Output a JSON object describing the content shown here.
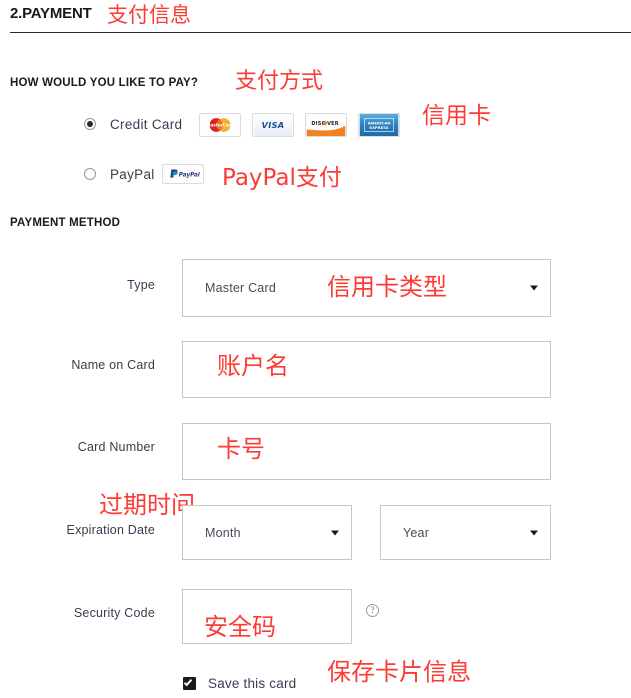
{
  "section": {
    "title": "2.PAYMENT",
    "title_annotation": "支付信息"
  },
  "pay_question": {
    "label": "HOW WOULD YOU LIKE TO PAY?",
    "annotation": "支付方式"
  },
  "payment_options": {
    "credit": {
      "label": "Credit Card",
      "selected": true,
      "annotation": "信用卡",
      "logos": [
        {
          "name": "mastercard-logo",
          "alt": "MasterCard"
        },
        {
          "name": "visa-logo",
          "alt": "VISA"
        },
        {
          "name": "discover-logo",
          "alt": "DISCOVER"
        },
        {
          "name": "amex-logo",
          "alt": "AMERICAN EXPRESS"
        }
      ]
    },
    "paypal": {
      "label": "PayPal",
      "selected": false,
      "annotation": "PayPal支付",
      "logo_alt": "PayPal"
    }
  },
  "payment_method": {
    "heading": "PAYMENT METHOD",
    "fields": {
      "type": {
        "label": "Type",
        "value": "Master Card",
        "annotation": "信用卡类型",
        "options": [
          "Master Card"
        ]
      },
      "name_on_card": {
        "label": "Name on Card",
        "value": "",
        "annotation": "账户名"
      },
      "card_number": {
        "label": "Card Number",
        "value": "",
        "annotation": "卡号"
      },
      "expiration_date": {
        "label": "Expiration Date",
        "annotation": "过期时间",
        "month_value": "Month",
        "year_value": "Year"
      },
      "security_code": {
        "label": "Security Code",
        "value": "",
        "annotation": "安全码",
        "help_glyph": "?"
      },
      "save_card": {
        "label": "Save this card",
        "checked": true,
        "annotation": "保存卡片信息"
      }
    }
  },
  "colors": {
    "annotation_red": "#fc3b35",
    "text": "#3b3b4f",
    "heading": "#1a1a1a",
    "border": "#c9c6c3",
    "visa_blue": "#1a4d8f",
    "mastercard_red": "#d8232a",
    "mastercard_yellow": "#f4a81d",
    "discover_orange": "#f48120",
    "amex_blue": "#2a7fc1",
    "paypal_blue": "#253b80"
  }
}
